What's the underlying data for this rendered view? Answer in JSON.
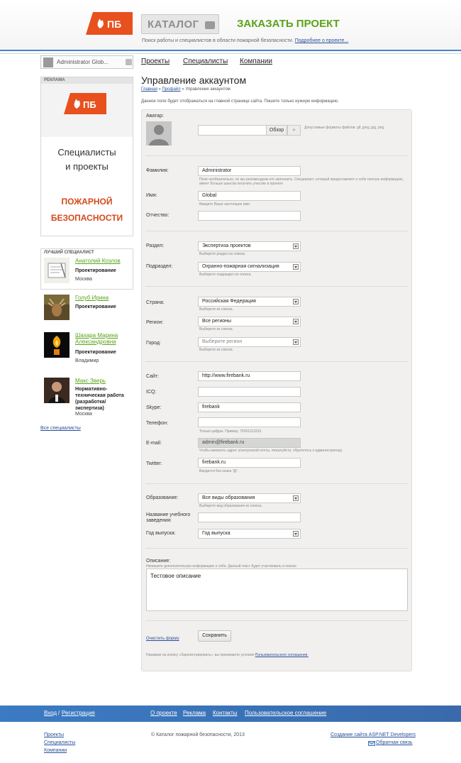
{
  "header": {
    "logo_text": "ПБ",
    "catalog_label": "КАТАЛОГ",
    "order_label": "ЗАКАЗАТЬ ПРОЕКТ",
    "tagline": "Поиск работы и специалистов в области пожарной безопасности.",
    "tagline_link": "Подробнее о проекте...",
    "brand_color": "#e8501d",
    "accent_color": "#5aa31a"
  },
  "user_menu": {
    "name": "Administrator Glob..."
  },
  "nav": {
    "projects": "Проекты",
    "specialists": "Специалисты",
    "companies": "Компании"
  },
  "ad": {
    "heading": "РЕКЛАМА",
    "logo_text": "ПБ",
    "line1": "Специалисты",
    "line2": "и проекты",
    "line3": "ПОЖАРНОЙ",
    "line4": "БЕЗОПАСНОСТИ"
  },
  "best": {
    "title": "ЛУЧШИЙ СПЕЦИАЛИСТ",
    "items": [
      {
        "name": "Анатолий Козлов",
        "role": "Проектирование",
        "city": "Москва"
      },
      {
        "name": "Голуб Ирина",
        "role": "Проектирование",
        "city": ""
      },
      {
        "name": "Шахара Марина Александровна",
        "role": "Проектирование",
        "city": "Владимир"
      },
      {
        "name": "Макс Зверь",
        "role": "Нормативно-техническая работа (разработка/экспертиза)",
        "city": "Москва"
      }
    ],
    "all_link": "Все специалисты"
  },
  "main": {
    "title": "Управление аккаунтом",
    "crumb_home": "Главная",
    "crumb_sep": "»",
    "crumb_profile": "Профайл",
    "crumb_current": "Управление аккаунтом",
    "intro": "Данное поле будет отображаться на главной странице сайта. Пишите только нужную информацию."
  },
  "form": {
    "avatar_label": "Аватар:",
    "browse_label": "Обзор",
    "plus_label": "+",
    "formats_hint": "Допустимые форматы файлов: gif, jpeg, jpg, png",
    "lastname_label": "Фамилия:",
    "lastname_value": "Administrator",
    "lastname_hint": "Поле необязательно, но мы рекомендуем его заполнить. Специалист, который предоставляет о себе полную информацию, имеет больше шансов получить участие в проекте",
    "firstname_label": "Имя:",
    "firstname_value": "Global",
    "firstname_hint": "Введите Ваше настоящее имя.",
    "patronymic_label": "Отчество:",
    "section_label": "Раздел:",
    "section_value": "Экспертиза проектов",
    "section_hint": "Выберите раздел из списка.",
    "subsection_label": "Подраздел:",
    "subsection_value": "Охранно-пожарная сигнализация",
    "subsection_hint": "Выберите подраздел из списка.",
    "country_label": "Страна:",
    "country_value": "Российская Федерация",
    "country_hint": "Выберите из списка.",
    "region_label": "Регион:",
    "region_value": "Все регионы",
    "region_hint": "Выберите из списка.",
    "city_label": "Город:",
    "city_value": "Выберите регион",
    "city_hint": "Выберите из списка.",
    "site_label": "Сайт:",
    "site_value": "http://www.firebank.ru",
    "icq_label": "ICQ:",
    "skype_label": "Skype:",
    "skype_value": "firebank",
    "phone_label": "Телефон:",
    "phone_hint": "Только цифры. Пример, 79261112233.",
    "email_label": "E-mail:",
    "email_value": "admin@firebank.ru",
    "email_hint": "Чтобы изменить адрес электронной почты, пожалуйста, обратитесь к администратору.",
    "twitter_label": "Twitter:",
    "twitter_value": "firebank.ru",
    "twitter_hint": "Вводится без знака '@'.",
    "education_label": "Образование:",
    "education_value": "Все виды образования",
    "education_hint": "Выберите вид образования из списка.",
    "institution_label": "Название учебного заведения:",
    "year_label": "Год выпуска:",
    "year_value": "Год выпуска",
    "description_label": "Описание:",
    "description_hint": "Напишите дополнительную информацию о себе. Данный текст будет участвовать в поиске",
    "description_value": "Тестовое описание",
    "clear_label": "Очистить форму",
    "save_label": "Сохранить",
    "terms_text": "Нажимая на кнопку «Зарегистрировать», вы принимаете условия",
    "terms_link": "Пользовательского соглашения."
  },
  "footer": {
    "login": "Вход",
    "sep": "/",
    "register": "Регистрация",
    "about": "О проекте",
    "ads": "Реклама",
    "contacts": "Контакты",
    "agreement": "Пользовательское соглашение",
    "link_projects": "Проекты",
    "link_specialists": "Специалисты",
    "link_companies": "Компании",
    "copyright": "© Каталог пожарной безопасности, 2013",
    "dev_link": "Создание сайта ASP.NET Developers",
    "feedback": "Обратная связь"
  }
}
